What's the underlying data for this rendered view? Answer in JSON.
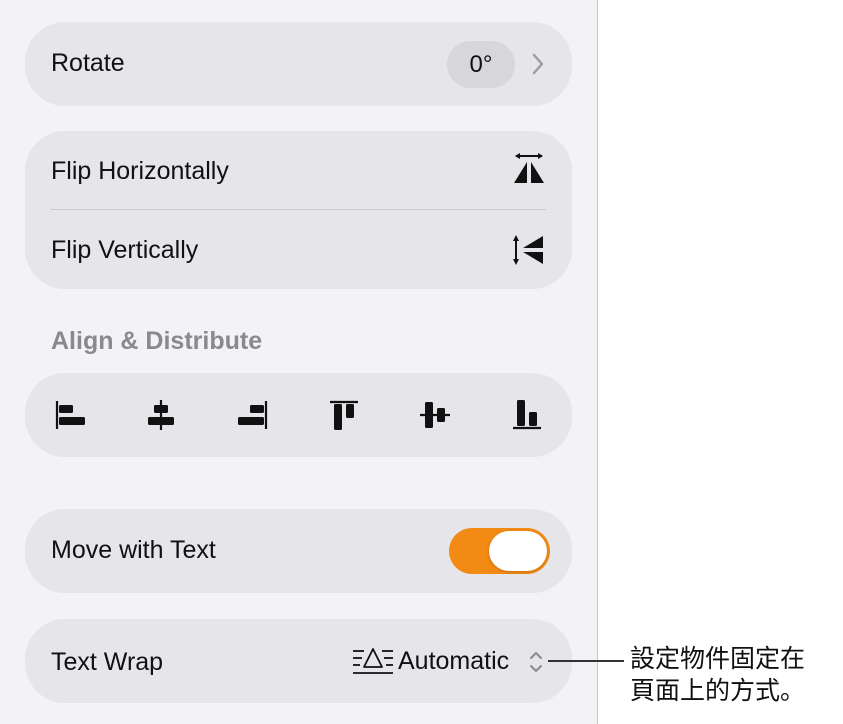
{
  "rotate": {
    "label": "Rotate",
    "value": "0°"
  },
  "flip": {
    "horizontal_label": "Flip Horizontally",
    "vertical_label": "Flip Vertically"
  },
  "align_section": {
    "header": "Align & Distribute",
    "buttons": [
      {
        "icon": "align-left-icon"
      },
      {
        "icon": "align-center-icon"
      },
      {
        "icon": "align-right-icon"
      },
      {
        "icon": "align-top-icon"
      },
      {
        "icon": "align-middle-icon"
      },
      {
        "icon": "align-bottom-icon"
      }
    ]
  },
  "move_with_text": {
    "label": "Move with Text",
    "on": true
  },
  "text_wrap": {
    "label": "Text Wrap",
    "value": "Automatic"
  },
  "callout": {
    "line1": "設定物件固定在",
    "line2": "頁面上的方式。"
  },
  "colors": {
    "accent": "#f28a14",
    "card": "#e5e5ea",
    "panel": "#f2f2f7",
    "header": "#8a8a8e"
  }
}
